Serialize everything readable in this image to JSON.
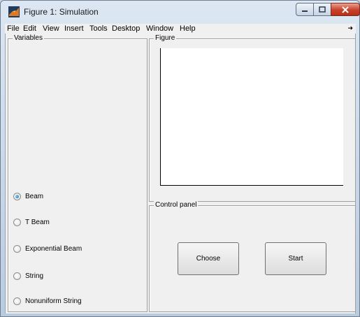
{
  "window": {
    "title": "Figure 1: Simulation"
  },
  "menu": [
    "File",
    "Edit",
    "View",
    "Insert",
    "Tools",
    "Desktop",
    "Window",
    "Help"
  ],
  "variables": {
    "title": "Variables",
    "options": [
      {
        "label": "Beam",
        "checked": true
      },
      {
        "label": "T Beam",
        "checked": false
      },
      {
        "label": "Exponential Beam",
        "checked": false
      },
      {
        "label": "String",
        "checked": false
      },
      {
        "label": "Nonuniform String",
        "checked": false
      }
    ]
  },
  "figure_panel": {
    "title": "Figure"
  },
  "control_panel": {
    "title": "Control panel",
    "choose_label": "Choose",
    "start_label": "Start"
  }
}
